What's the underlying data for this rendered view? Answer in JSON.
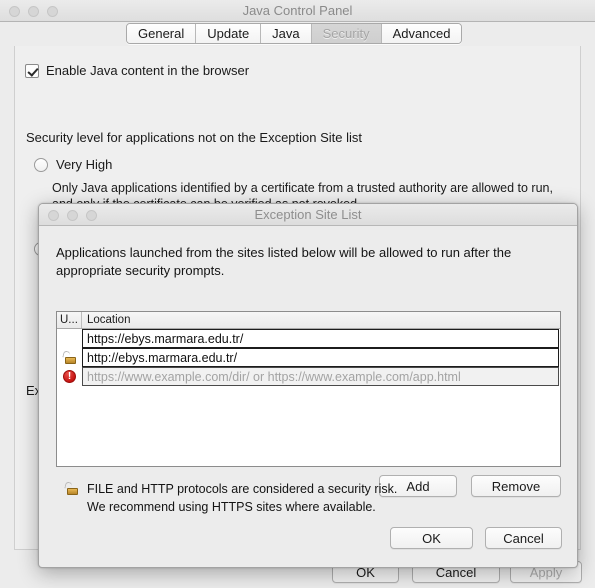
{
  "main_window": {
    "title": "Java Control Panel",
    "traffic_lights": [
      "close-button",
      "minimize-button",
      "maximize-button"
    ],
    "tabs": [
      {
        "label": "General",
        "selected": false
      },
      {
        "label": "Update",
        "selected": false
      },
      {
        "label": "Java",
        "selected": false
      },
      {
        "label": "Security",
        "selected": true
      },
      {
        "label": "Advanced",
        "selected": false
      }
    ],
    "enable_java_checkbox": {
      "label": "Enable Java content in the browser",
      "checked": true
    },
    "security_level_title": "Security level for applications not on the Exception Site list",
    "security_options": [
      {
        "label": "Very High",
        "selected": false,
        "description": "Only Java applications identified by a certificate from a trusted authority are allowed to run, and only if the certificate can be verified as not revoked."
      }
    ],
    "exception_section_label": "Exception Site List",
    "footer_buttons": [
      {
        "label": "OK",
        "disabled": false
      },
      {
        "label": "Cancel",
        "disabled": false
      },
      {
        "label": "Apply",
        "disabled": true
      }
    ]
  },
  "dialog": {
    "title": "Exception Site List",
    "description": "Applications launched from the sites listed below will be allowed to run after the appropriate security prompts.",
    "table": {
      "columns": [
        "U...",
        "Location"
      ],
      "rows": [
        {
          "icon": "none",
          "location": "https://ebys.marmara.edu.tr/",
          "placeholder": false
        },
        {
          "icon": "unlocked-padlock-icon",
          "location": "http://ebys.marmara.edu.tr/",
          "placeholder": false
        },
        {
          "icon": "error-badge-icon",
          "location": "https://www.example.com/dir/ or https://www.example.com/app.html",
          "placeholder": true
        }
      ]
    },
    "list_buttons": [
      {
        "label": "Add"
      },
      {
        "label": "Remove"
      }
    ],
    "warning": {
      "icon": "unlocked-padlock-icon",
      "line1": "FILE and HTTP protocols are considered a security risk.",
      "line2": "We recommend using HTTPS sites where available."
    },
    "footer_buttons": [
      {
        "label": "OK"
      },
      {
        "label": "Cancel"
      }
    ]
  },
  "colors": {
    "window_background": "#ececec",
    "panel_background": "#efefef",
    "title_text": "#8a8a8a",
    "error_red": "#c4100e",
    "padlock_gold": "#b8862a",
    "placeholder_text": "#a3a3a3"
  }
}
